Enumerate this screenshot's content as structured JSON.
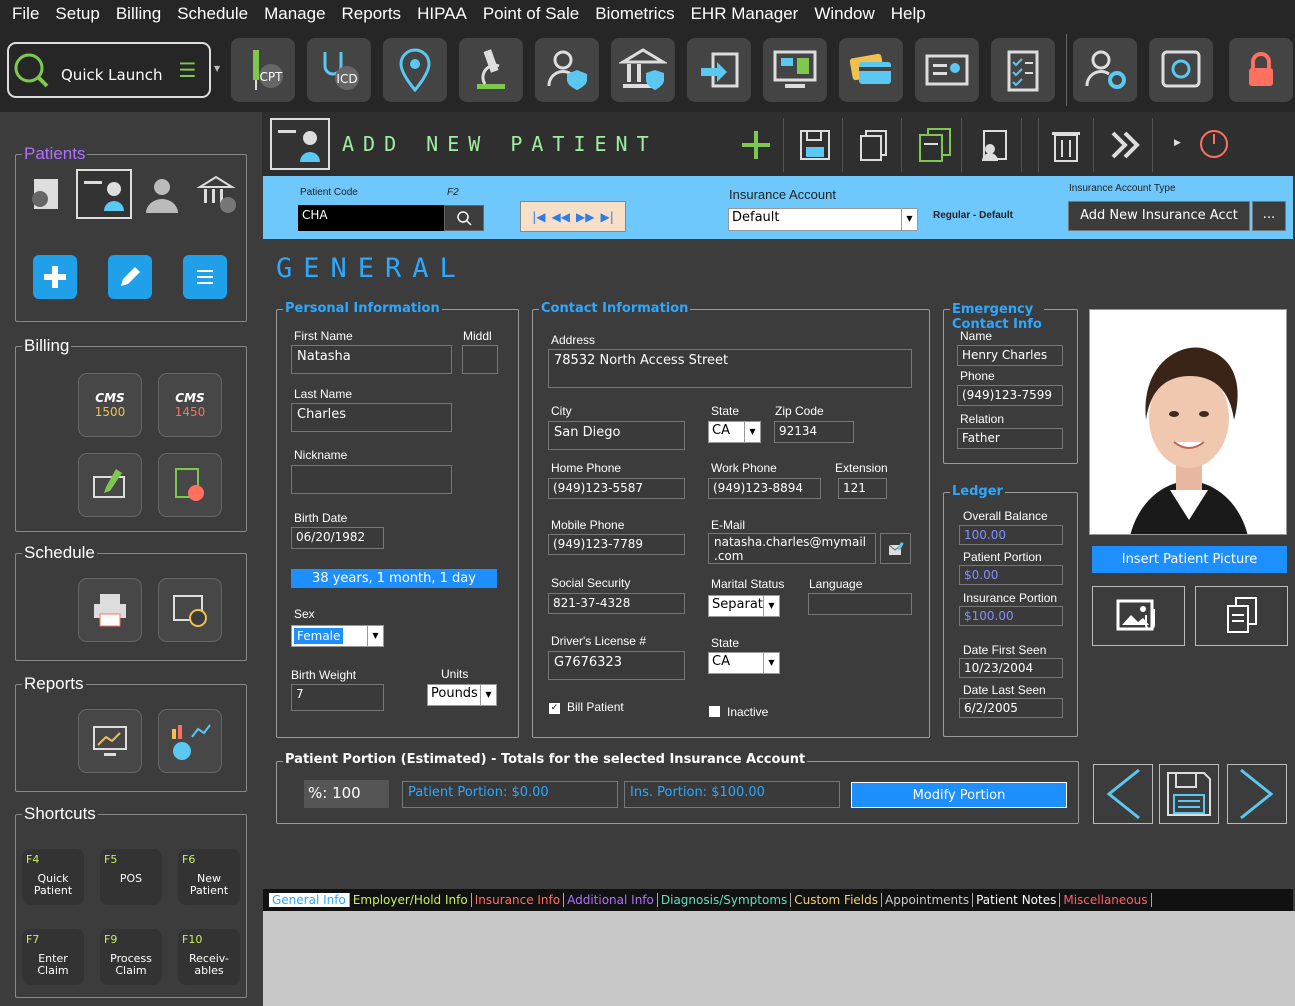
{
  "menu": [
    "File",
    "Setup",
    "Billing",
    "Schedule",
    "Manage",
    "Reports",
    "HIPAA",
    "Point of Sale",
    "Biometrics",
    "EHR Manager",
    "Window",
    "Help"
  ],
  "toolbar": {
    "quick_launch": "Quick Launch",
    "cpt": "CPT",
    "icd": "ICD"
  },
  "sidebar": {
    "patients_title": "Patients",
    "billing_title": "Billing",
    "schedule_title": "Schedule",
    "reports_title": "Reports",
    "shortcuts_title": "Shortcuts",
    "cms1500": "1500",
    "cms1450": "1450",
    "cms": "CMS",
    "shortcuts": [
      {
        "key": "F4",
        "label": "Quick Patient"
      },
      {
        "key": "F5",
        "label": "POS"
      },
      {
        "key": "F6",
        "label": "New Patient"
      },
      {
        "key": "F7",
        "label": "Enter Claim"
      },
      {
        "key": "F9",
        "label": "Process Claim"
      },
      {
        "key": "F10",
        "label": "Receiv-ables"
      }
    ]
  },
  "header": {
    "title": "ADD NEW PATIENT"
  },
  "bluebar": {
    "patient_code_label": "Patient Code",
    "f2": "F2",
    "patient_code_value": "CHA",
    "insurance_account_label": "Insurance Account",
    "insurance_account_value": "Default",
    "regular_default": "Regular - Default",
    "insurance_type_label": "Insurance Account Type",
    "add_insurance": "Add New Insurance Acct",
    "more": "..."
  },
  "section_title": "GENERAL",
  "personal": {
    "title": "Personal Information",
    "first_name_label": "First Name",
    "first_name": "Natasha",
    "middle_label": "Middl",
    "last_name_label": "Last Name",
    "last_name": "Charles",
    "nickname_label": "Nickname",
    "birth_date_label": "Birth Date",
    "birth_date": "06/20/1982",
    "age": "38 years, 1 month, 1 day",
    "sex_label": "Sex",
    "sex": "Female",
    "birth_weight_label": "Birth Weight",
    "birth_weight": "7",
    "units_label": "Units",
    "units": "Pounds"
  },
  "contact": {
    "title": "Contact Information",
    "address_label": "Address",
    "address": "78532 North Access Street",
    "city_label": "City",
    "city": "San Diego",
    "state_label": "State",
    "state": "CA",
    "zip_label": "Zip Code",
    "zip": "92134",
    "home_phone_label": "Home Phone",
    "home_phone": "(949)123-5587",
    "work_phone_label": "Work Phone",
    "work_phone": "(949)123-8894",
    "extension_label": "Extension",
    "extension": "121",
    "mobile_label": "Mobile Phone",
    "mobile": "(949)123-7789",
    "email_label": "E-Mail",
    "email1": "natasha.charles@mymail",
    "email2": ".com",
    "ssn_label": "Social Security",
    "ssn": "821-37-4328",
    "marital_label": "Marital Status",
    "marital": "Separat",
    "language_label": "Language",
    "dl_label": "Driver's License #",
    "dl": "G7676323",
    "dl_state_label": "State",
    "dl_state": "CA",
    "bill_patient": "Bill Patient",
    "inactive": "Inactive"
  },
  "emergency": {
    "title1": "Emergency",
    "title2": "Contact Info",
    "name_label": "Name",
    "name": "Henry Charles",
    "phone_label": "Phone",
    "phone": "(949)123-7599",
    "relation_label": "Relation",
    "relation": "Father"
  },
  "ledger": {
    "title": "Ledger",
    "overall_label": "Overall Balance",
    "overall": "100.00",
    "patient_label": "Patient Portion",
    "patient": "$0.00",
    "ins_label": "Insurance Portion",
    "ins": "$100.00",
    "first_seen_label": "Date First Seen",
    "first_seen": "10/23/2004",
    "last_seen_label": "Date Last Seen",
    "last_seen": "6/2/2005"
  },
  "picture": {
    "insert": "Insert Patient Picture"
  },
  "portion": {
    "title": "Patient Portion (Estimated) - Totals for the selected Insurance Account",
    "pct": "%: 100",
    "patient": "Patient Portion: $0.00",
    "ins": "Ins. Portion: $100.00",
    "modify": "Modify Portion"
  },
  "tabs": [
    {
      "label": "General Info",
      "color": "#2ea8ff",
      "bg": "#ffffff"
    },
    {
      "label": "Employer/Hold Info",
      "color": "#c8f060"
    },
    {
      "label": "Insurance Info",
      "color": "#ff7060"
    },
    {
      "label": "Additional Info",
      "color": "#b070ff"
    },
    {
      "label": "Diagnosis/Symptoms",
      "color": "#60e0c0"
    },
    {
      "label": "Custom Fields",
      "color": "#f0d080"
    },
    {
      "label": "Appointments",
      "color": "#cccccc"
    },
    {
      "label": "Patient Notes",
      "color": "#ffffff"
    },
    {
      "label": "Miscellaneous",
      "color": "#ff6070"
    }
  ],
  "colors": {
    "accent": "#2ea8ff",
    "green": "#9ef0a0",
    "blue_bar": "#6fc8fb"
  }
}
